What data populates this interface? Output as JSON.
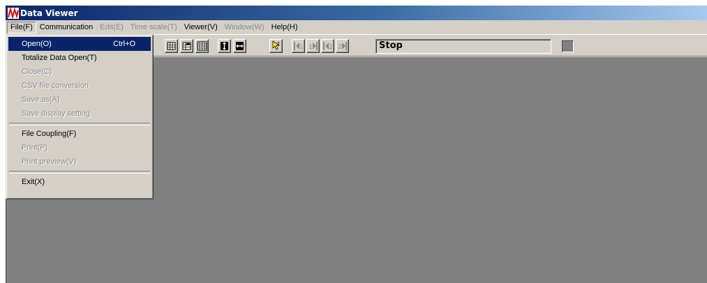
{
  "window": {
    "title": "Data Viewer",
    "app_icon": "waveform-icon"
  },
  "menubar": {
    "items": [
      {
        "label": "File(F)",
        "enabled": true,
        "active": true
      },
      {
        "label": "Communication",
        "enabled": true
      },
      {
        "label": "Edit(E)",
        "enabled": false
      },
      {
        "label": "Time scale(T)",
        "enabled": false
      },
      {
        "label": "Viewer(V)",
        "enabled": true
      },
      {
        "label": "Window(W)",
        "enabled": false
      },
      {
        "label": "Help(H)",
        "enabled": true
      }
    ]
  },
  "file_menu": {
    "items": [
      {
        "label": "Open(O)",
        "shortcut": "Ctrl+O",
        "enabled": true,
        "selected": true
      },
      {
        "label": "Totalize Data Open(T)",
        "enabled": true
      },
      {
        "label": "Close(C)",
        "enabled": false
      },
      {
        "label": "CSV file conversion",
        "enabled": false
      },
      {
        "label": "Save as(A)",
        "enabled": false
      },
      {
        "label": "Save display setting",
        "enabled": false
      },
      {
        "separator": true
      },
      {
        "label": "File Coupling(F)",
        "enabled": true
      },
      {
        "label": "Print(P)",
        "enabled": false
      },
      {
        "label": "Print preview(V)",
        "enabled": false
      },
      {
        "separator": true
      },
      {
        "label": "Exit(X)",
        "enabled": true
      }
    ]
  },
  "toolbar": {
    "buttons": [
      {
        "icon": "grid-small-icon"
      },
      {
        "icon": "grid-list-icon"
      },
      {
        "icon": "grid-large-icon"
      },
      {
        "icon": "vertical-cursor-icon"
      },
      {
        "icon": "horizontal-cursor-icon"
      },
      {
        "icon": "help-pointer-icon"
      },
      {
        "icon": "cursor1-left-icon",
        "text": "1"
      },
      {
        "icon": "cursor1-right-icon",
        "text": "1"
      },
      {
        "icon": "cursor2-left-icon",
        "text": "2"
      },
      {
        "icon": "cursor2-right-icon",
        "text": "2"
      }
    ],
    "status": "Stop",
    "indicator_color": "#808080"
  },
  "colors": {
    "titlebar_start": "#0a246a",
    "titlebar_end": "#a6caf0",
    "face": "#d4d0c8",
    "client": "#808080",
    "selection": "#0a246a"
  }
}
